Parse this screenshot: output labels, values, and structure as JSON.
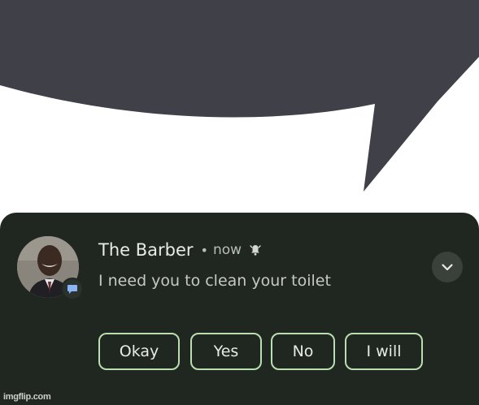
{
  "colors": {
    "speech_bubble": "#3f4048",
    "notification_background": "#202721",
    "button_border": "#b9dfb0",
    "primary_text": "#e8ebe6",
    "secondary_text": "#c4c9c2",
    "app_badge_icon": "#8ab4f8"
  },
  "notification": {
    "sender": "The Barber",
    "separator": "•",
    "time": "now",
    "alert_icon": "bell-alert-icon",
    "message": "I need you to clean your toilet",
    "expand_icon": "chevron-down-icon",
    "app_icon": "chat-bubble-icon",
    "avatar_icon": "profile-photo"
  },
  "quick_replies": [
    "Okay",
    "Yes",
    "No",
    "I will"
  ],
  "watermark": "imgflip.com"
}
